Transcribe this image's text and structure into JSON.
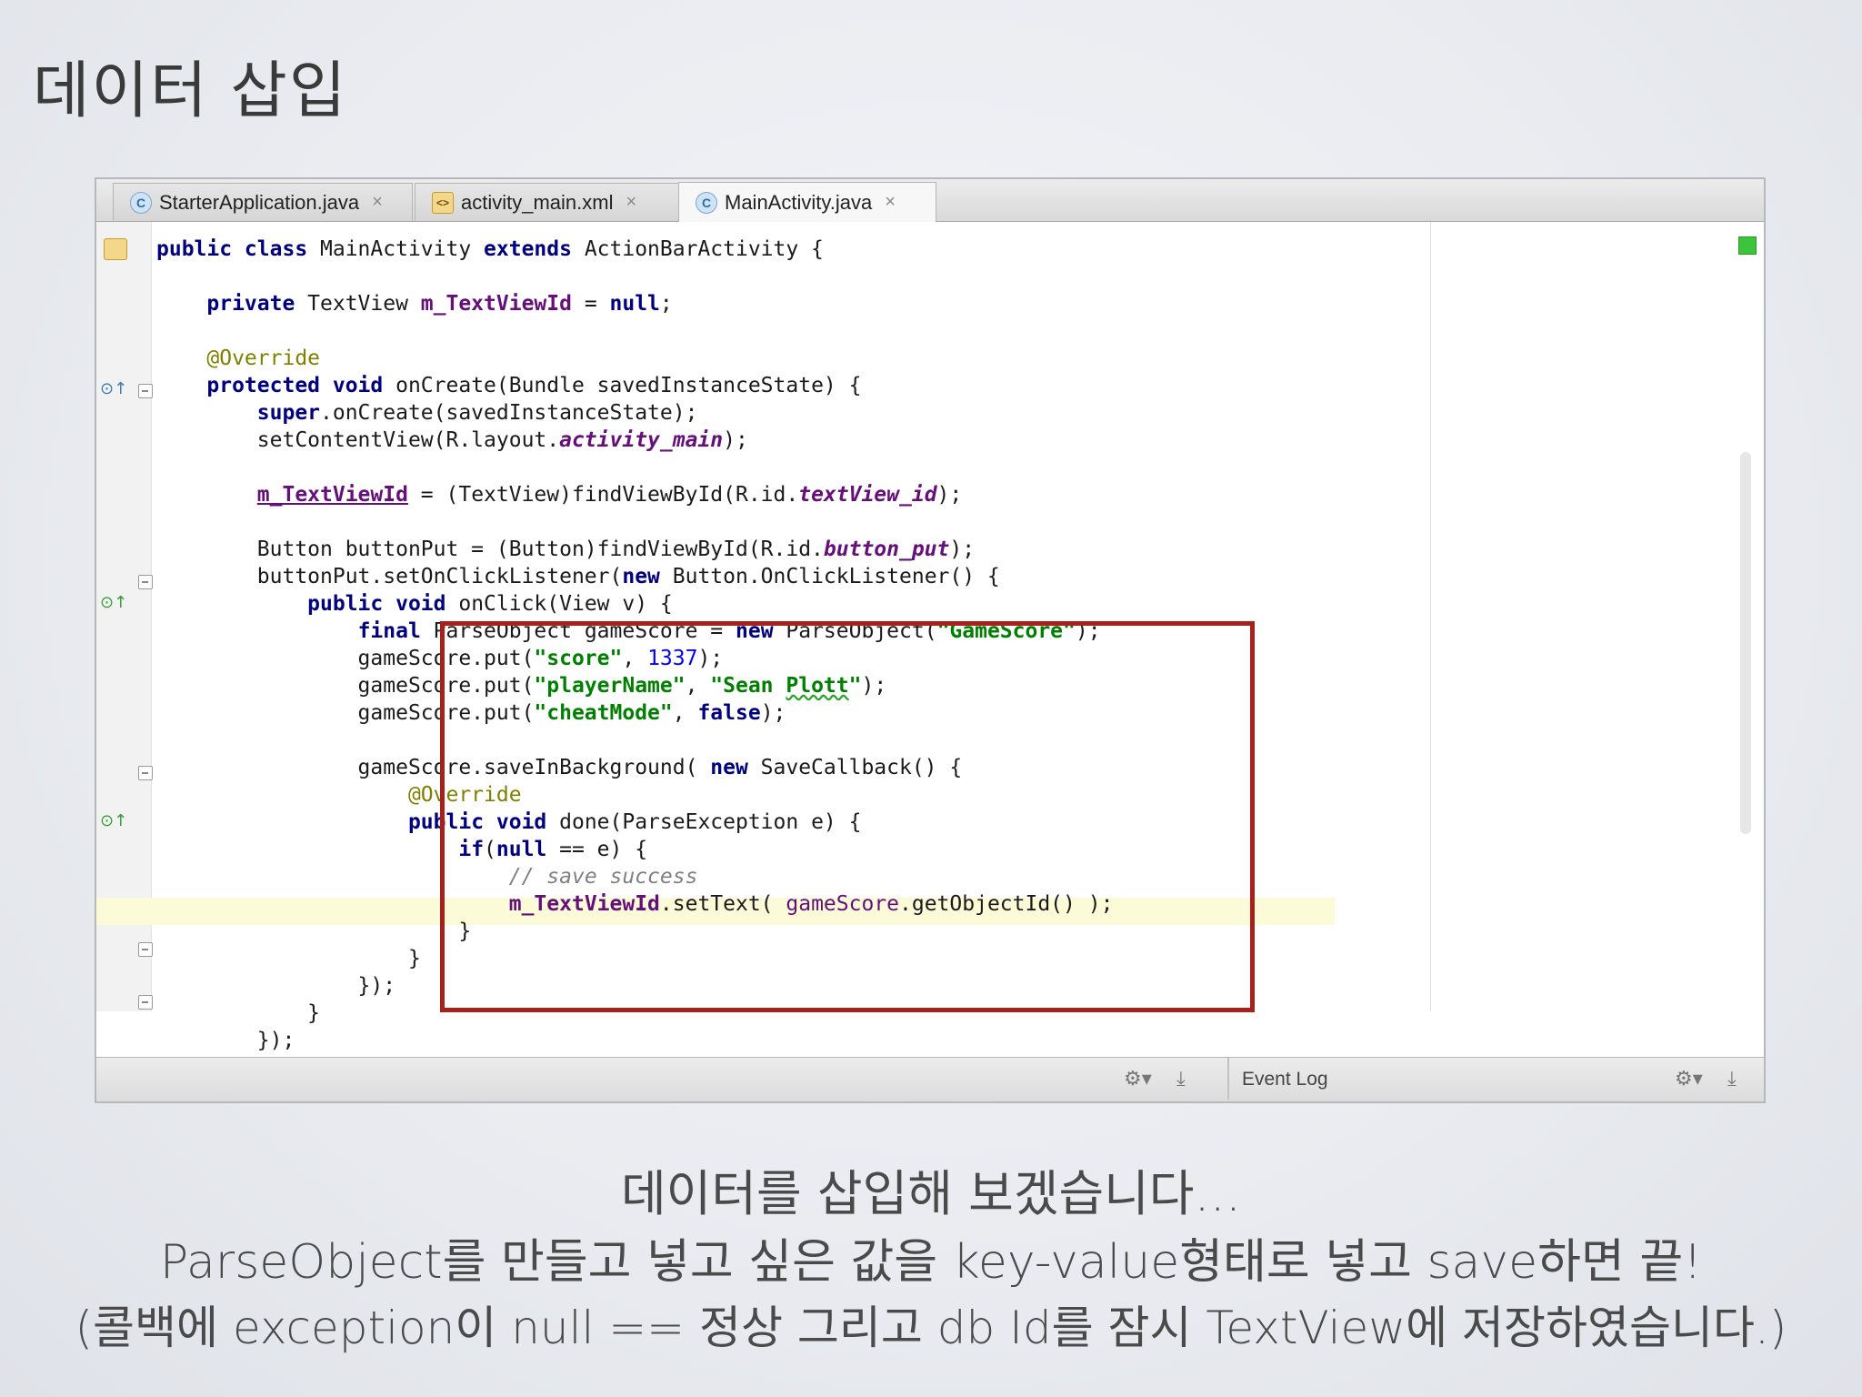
{
  "slide": {
    "title": "데이터 삽입",
    "captions": [
      "데이터를 삽입해 보겠습니다...",
      "ParseObject를 만들고 넣고 싶은 값을 key-value형태로 넣고 save하면 끝!",
      "(콜백에 exception이 null == 정상 그리고 db Id를 잠시 TextView에 저장하였습니다.)"
    ]
  },
  "editor": {
    "tabs": [
      {
        "label": "StarterApplication.java",
        "icon": "C",
        "close": "×"
      },
      {
        "label": "activity_main.xml",
        "icon": "<>",
        "close": "×"
      },
      {
        "label": "MainActivity.java",
        "icon": "C",
        "close": "×"
      }
    ],
    "code": {
      "l1": {
        "a": "public class ",
        "b": "MainActivity ",
        "c": "extends ",
        "d": "ActionBarActivity {"
      },
      "l2": {
        "a": "    private ",
        "b": "TextView ",
        "c": "m_TextViewId",
        "d": " = ",
        "e": "null",
        "f": ";"
      },
      "l3": {
        "a": "    @Override"
      },
      "l4": {
        "a": "    protected void ",
        "b": "onCreate(Bundle savedInstanceState) {"
      },
      "l5": {
        "a": "        super",
        "b": ".onCreate(savedInstanceState);"
      },
      "l6": {
        "a": "        setContentView(R.layout.",
        "b": "activity_main",
        "c": ");"
      },
      "l7": {
        "a": "        ",
        "b": "m_TextViewId",
        "c": " = (TextView)findViewById(R.id.",
        "d": "textView_id",
        "e": ");"
      },
      "l8": {
        "a": "        Button buttonPut = (Button)findViewById(R.id.",
        "b": "button_put",
        "c": ");"
      },
      "l9": {
        "a": "        buttonPut.setOnClickListener(",
        "b": "new ",
        "c": "Button.OnClickListener() {"
      },
      "l10": {
        "a": "            ",
        "b": "public void ",
        "c": "onClick(View v) {"
      },
      "l11": {
        "a": "                ",
        "b": "final ",
        "c": "ParseObject gameScore = ",
        "d": "new ",
        "e": "ParseObject(",
        "f": "\"GameScore\"",
        "g": ");"
      },
      "l12": {
        "a": "                gameScore.put(",
        "b": "\"score\"",
        "c": ", ",
        "d": "1337",
        "e": ");"
      },
      "l13": {
        "a": "                gameScore.put(",
        "b": "\"playerName\"",
        "c": ", ",
        "d": "\"Sean ",
        "e": "Plott",
        "f": "\"",
        "g": ");"
      },
      "l14": {
        "a": "                gameScore.put(",
        "b": "\"cheatMode\"",
        "c": ", ",
        "d": "false",
        "e": ");"
      },
      "l15": {
        "a": "                gameScore.saveInBackground( ",
        "b": "new ",
        "c": "SaveCallback() {"
      },
      "l16": {
        "a": "                    @Override"
      },
      "l17": {
        "a": "                    ",
        "b": "public void ",
        "c": "done(ParseException e) {"
      },
      "l18": {
        "a": "                        ",
        "b": "if",
        "c": "(",
        "d": "null",
        "e": " == e) {"
      },
      "l19": {
        "a": "                            ",
        "b": "// save success"
      },
      "l20": {
        "a": "                            ",
        "b": "m_TextViewId",
        "c": ".setText( ",
        "d": "gameScore",
        "e": ".getObjectId() );"
      },
      "l21": {
        "a": "                        }"
      },
      "l22": {
        "a": "                    }"
      },
      "l23": {
        "a": "                });"
      },
      "l24": {
        "a": "            }"
      },
      "l25": {
        "a": "        });"
      }
    },
    "statusbar": {
      "event_log": "Event Log"
    }
  }
}
